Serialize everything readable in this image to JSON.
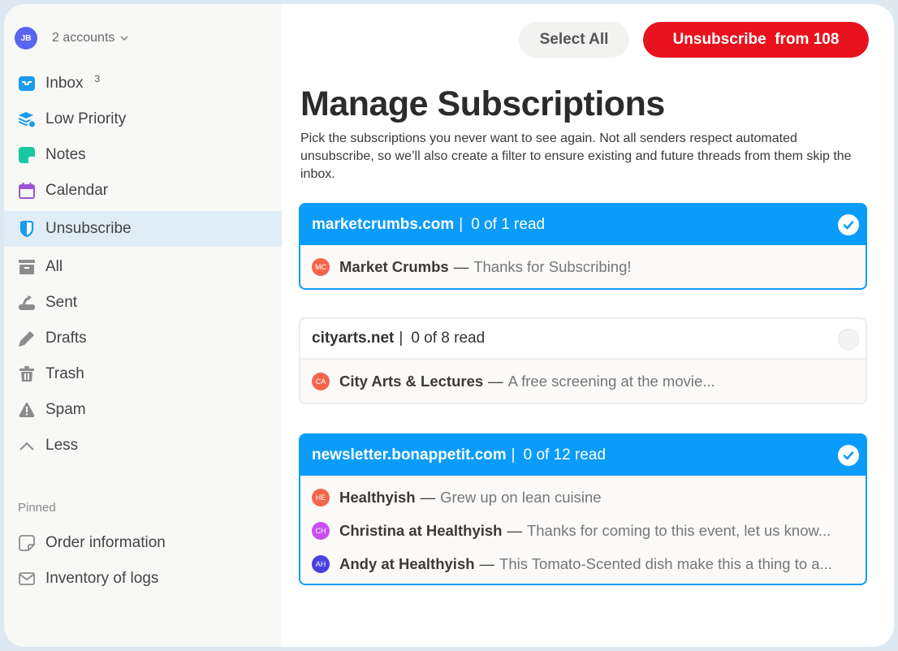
{
  "account": {
    "initials": "JB",
    "label": "2 accounts",
    "avatar_color": "#5864f2"
  },
  "sidebar": {
    "items": [
      {
        "label": "Inbox",
        "badge": "3",
        "icon": "inbox-icon"
      },
      {
        "label": "Low Priority",
        "icon": "low-priority-icon"
      },
      {
        "label": "Notes",
        "icon": "notes-icon"
      },
      {
        "label": "Calendar",
        "icon": "calendar-icon"
      },
      {
        "label": "Unsubscribe",
        "icon": "shield-icon",
        "active": true
      },
      {
        "label": "All",
        "icon": "archive-icon"
      },
      {
        "label": "Sent",
        "icon": "sent-icon"
      },
      {
        "label": "Drafts",
        "icon": "pencil-icon"
      },
      {
        "label": "Trash",
        "icon": "trash-icon"
      },
      {
        "label": "Spam",
        "icon": "warning-icon"
      },
      {
        "label": "Less",
        "icon": "chevron-up-icon"
      }
    ],
    "pinned_title": "Pinned",
    "pinned": [
      {
        "label": "Order information",
        "icon": "note-outline-icon"
      },
      {
        "label": "Inventory of logs",
        "icon": "envelope-icon"
      }
    ]
  },
  "toolbar": {
    "select_all_label": "Select All",
    "unsubscribe_label": "Unsubscribe  from 108",
    "unsubscribe_color": "#e8121f"
  },
  "page": {
    "title": "Manage Subscriptions",
    "description": "Pick the subscriptions you never want to see again. Not all senders respect automated unsubscribe, so we’ll also create a filter to ensure existing and future threads from them skip the inbox."
  },
  "accent_color": "#0a9cfb",
  "subscriptions": [
    {
      "domain": "marketcrumbs.com",
      "read": "0 of 1 read",
      "selected": true,
      "messages": [
        {
          "initials": "MC",
          "color": "#f5654a",
          "sender": "Market Crumbs",
          "snippet": "Thanks for Subscribing!"
        }
      ]
    },
    {
      "domain": "cityarts.net",
      "read": "0 of 8 read",
      "selected": false,
      "messages": [
        {
          "initials": "CA",
          "color": "#f5654a",
          "sender": "City Arts & Lectures",
          "snippet": "A free screening at the movie..."
        }
      ]
    },
    {
      "domain": "newsletter.bonappetit.com",
      "read": "0 of 12 read",
      "selected": true,
      "messages": [
        {
          "initials": "HE",
          "color": "#f5654a",
          "sender": "Healthyish",
          "snippet": "Grew up on lean cuisine"
        },
        {
          "initials": "CH",
          "color": "#c94ef0",
          "sender": "Christina at Healthyish",
          "snippet": "Thanks for coming to this event, let us know..."
        },
        {
          "initials": "AH",
          "color": "#4b3fe0",
          "sender": "Andy at Healthyish",
          "snippet": "This Tomato-Scented dish make this a thing to a..."
        }
      ]
    }
  ]
}
